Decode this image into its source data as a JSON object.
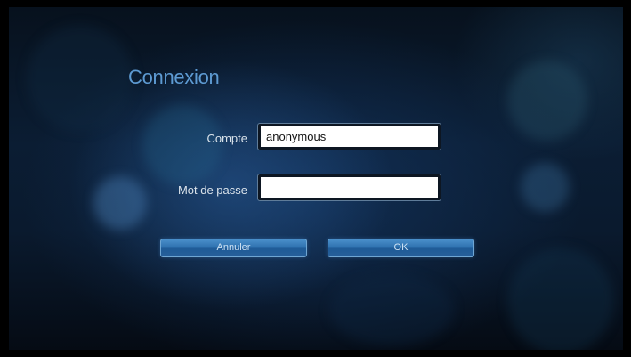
{
  "dialog": {
    "title": "Connexion",
    "account_label": "Compte",
    "account_value": "anonymous",
    "password_label": "Mot de passe",
    "password_value": "",
    "cancel_label": "Annuler",
    "ok_label": "OK"
  },
  "colors": {
    "title": "#5d9ad2",
    "button": "#2f72b0",
    "background": "#0b1d33"
  }
}
